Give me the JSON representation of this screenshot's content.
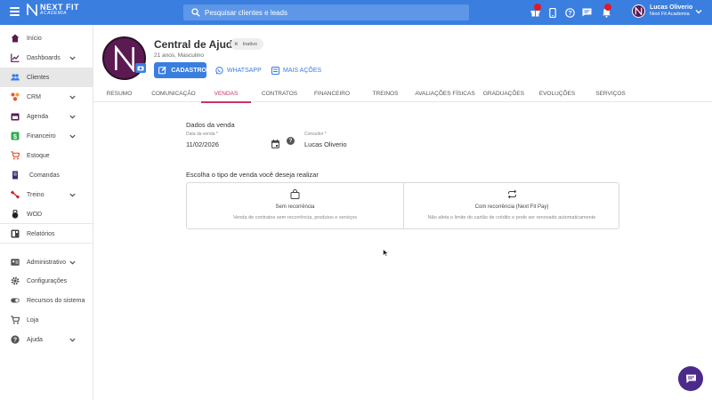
{
  "topbar": {
    "logo_line1": "NEXT FIT",
    "logo_line2": "ACADEMIA",
    "search_placeholder": "Pesquisar clientes e leads",
    "icons": [
      "gift-icon",
      "mobile-icon",
      "help-icon",
      "chat-icon",
      "bell-icon"
    ],
    "user_name": "Lucas Oliverio",
    "user_org": "Next Fit Academia"
  },
  "sidebar": {
    "items": [
      {
        "label": "Início",
        "icon": "home-icon",
        "color": "#5b1a52",
        "chevron": false
      },
      {
        "label": "Dashboards",
        "icon": "chart-icon",
        "color": "#5b1a52",
        "chevron": true
      },
      {
        "label": "Clientes",
        "icon": "users-icon",
        "color": "#3a7ee0",
        "chevron": false,
        "active": true
      },
      {
        "label": "CRM",
        "icon": "crm-icon",
        "color": "#e8552c",
        "chevron": true
      },
      {
        "label": "Agenda",
        "icon": "calendar-icon",
        "color": "#5b1a52",
        "chevron": true
      },
      {
        "label": "Financeiro",
        "icon": "money-icon",
        "color": "#2eab52",
        "chevron": true
      },
      {
        "label": "Estoque",
        "icon": "cart-icon",
        "color": "#e8552c",
        "chevron": false
      },
      {
        "label": "Comandas",
        "icon": "receipt-icon",
        "color": "#3b2a7a",
        "chevron": false
      },
      {
        "label": "Treino",
        "icon": "dumbbell-icon",
        "color": "#d0252c",
        "chevron": true
      },
      {
        "label": "WOD",
        "icon": "kettlebell-icon",
        "color": "#222222",
        "chevron": false
      },
      {
        "label": "Relatórios",
        "icon": "report-icon",
        "color": "#444444",
        "chevron": false
      },
      {
        "label": "Administrativo",
        "icon": "id-card-icon",
        "color": "#555555",
        "chevron": true
      },
      {
        "label": "Configurações",
        "icon": "gear-icon",
        "color": "#555555",
        "chevron": false
      },
      {
        "label": "Recursos do sistema",
        "icon": "toggle-icon",
        "color": "#555555",
        "chevron": false
      },
      {
        "label": "Loja",
        "icon": "shop-icon",
        "color": "#555555",
        "chevron": false
      },
      {
        "label": "Ajuda",
        "icon": "question-icon",
        "color": "#555555",
        "chevron": true
      }
    ]
  },
  "profile": {
    "name": "Central de Ajuda",
    "status": "Inativo",
    "meta": "21 anos, Masculino",
    "cadastro_label": "CADASTRO",
    "whatsapp_label": "WHATSAPP",
    "more_actions_label": "MAIS AÇÕES"
  },
  "tabs": [
    {
      "label": "RESUMO",
      "active": false
    },
    {
      "label": "COMUNICAÇÃO",
      "active": false
    },
    {
      "label": "VENDAS",
      "active": true
    },
    {
      "label": "CONTRATOS",
      "active": false
    },
    {
      "label": "FINANCEIRO",
      "active": false
    },
    {
      "label": "TREINOS",
      "active": false
    },
    {
      "label": "AVALIAÇÕES FÍSICAS",
      "active": false
    },
    {
      "label": "GRADUAÇÕES",
      "active": false
    },
    {
      "label": "EVOLUÇÕES",
      "active": false
    },
    {
      "label": "SERVIÇOS",
      "active": false
    }
  ],
  "sale": {
    "section_title": "Dados da venda",
    "date_label": "Data da venda *",
    "date_value": "11/02/2026",
    "consultant_label": "Consultor *",
    "consultant_value": "Lucas Oliverio",
    "choose_title": "Escolha o tipo de venda você deseja realizar",
    "options": [
      {
        "title": "Sem recorrência",
        "desc": "Venda de contratos sem recorrência, produtos e serviços",
        "icon": "bag-icon"
      },
      {
        "title": "Com recorrência (Next Fit Pay)",
        "desc": "Não afeta o limite do cartão de crédito e pode ser renovado automaticamente",
        "icon": "repeat-icon"
      }
    ]
  },
  "colors": {
    "primary": "#3a7ee0",
    "accent_tab": "#c8326b",
    "avatar": "#5b1a52",
    "chat": "#4b2a8a"
  }
}
